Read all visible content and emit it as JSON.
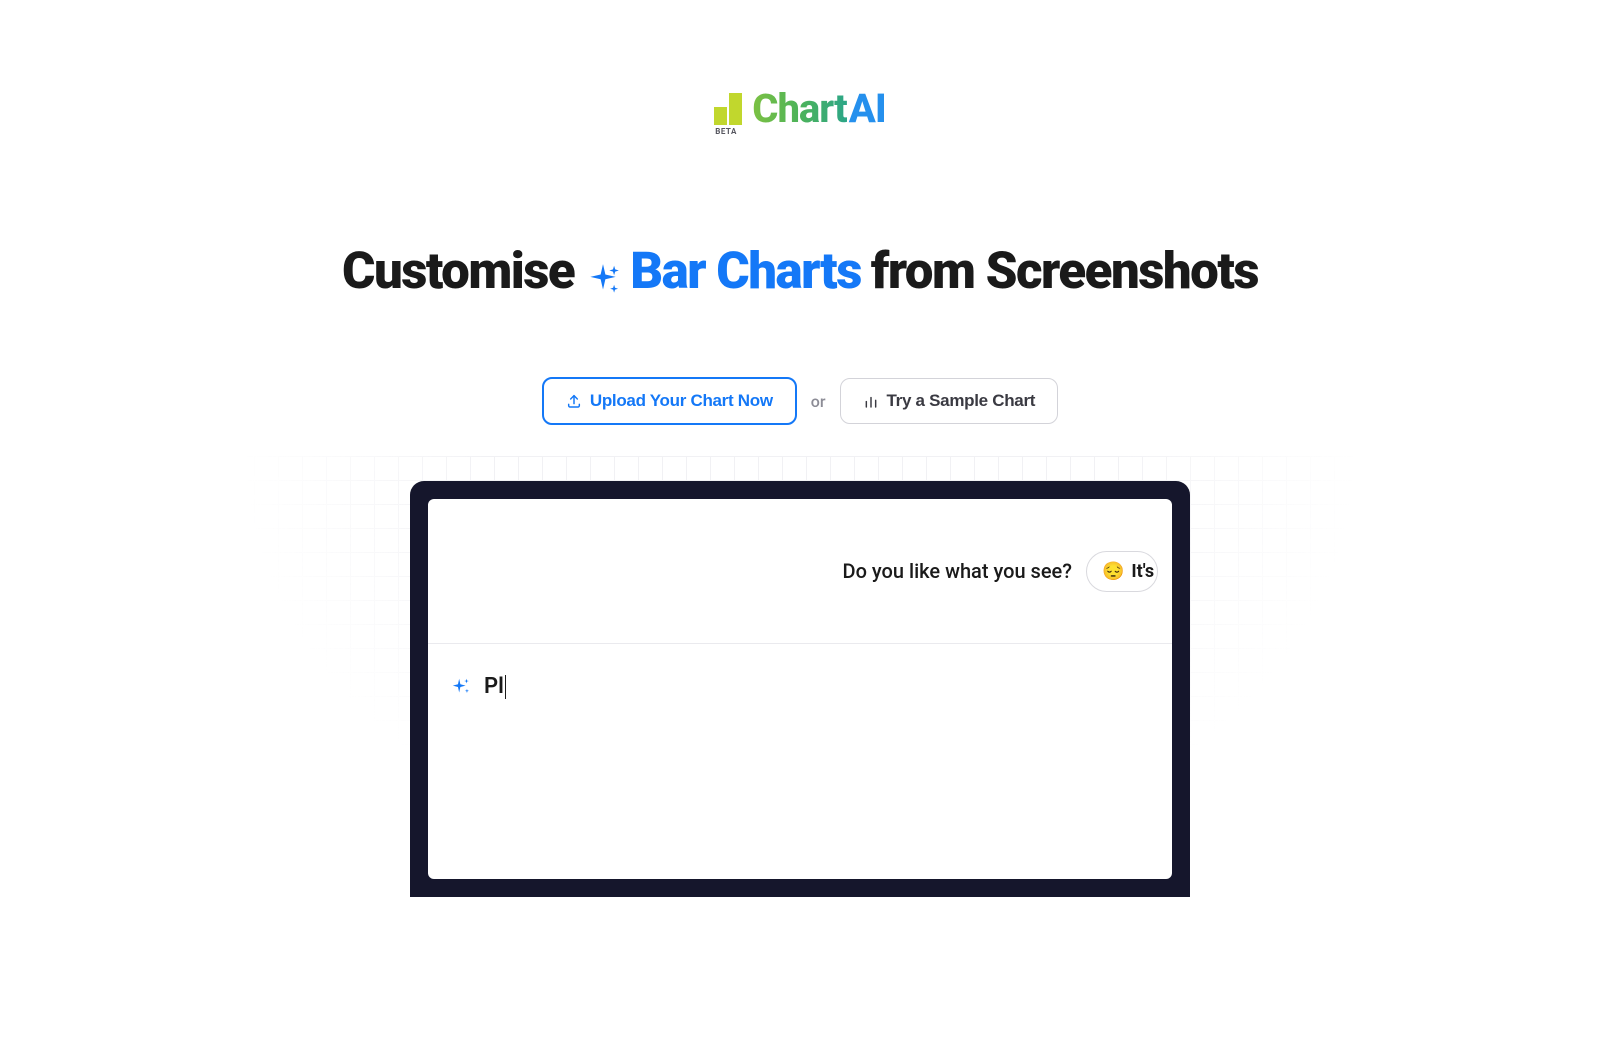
{
  "logo": {
    "beta": "BETA",
    "chart": "Chart",
    "ai": "AI"
  },
  "headline": {
    "prefix": "Customise",
    "highlight": "Bar Charts",
    "suffix": "from Screenshots"
  },
  "actions": {
    "upload": "Upload Your Chart Now",
    "or": "or",
    "sample": "Try a Sample Chart"
  },
  "preview": {
    "question": "Do you like what you see?",
    "badge_emoji": "😔",
    "badge_text": "It's B",
    "typed": "Pl"
  }
}
